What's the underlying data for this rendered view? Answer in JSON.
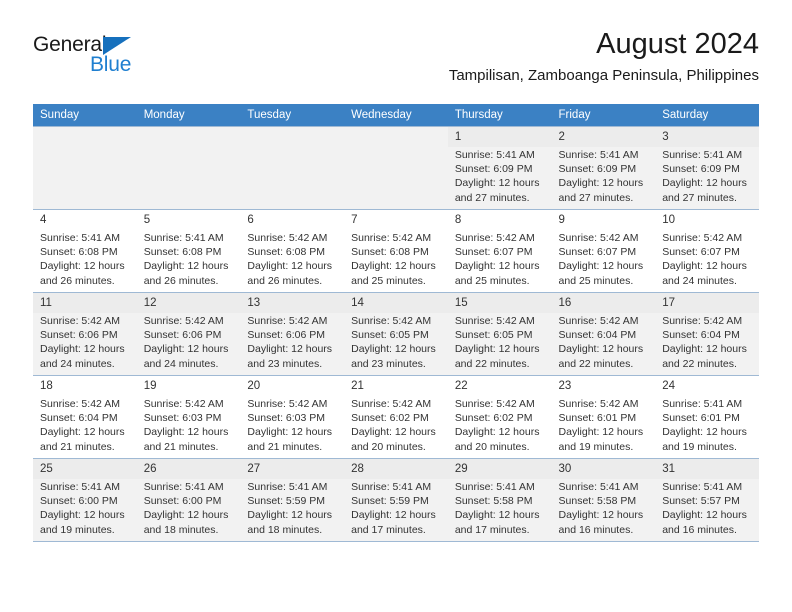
{
  "brand": {
    "name_top": "General",
    "name_bottom": "Blue",
    "triangle_color": "#1670bd",
    "blue_color": "#1f7fd0"
  },
  "header": {
    "title": "August 2024",
    "subtitle": "Tampilisan, Zamboanga Peninsula, Philippines"
  },
  "colors": {
    "header_row_bg": "#3b81c4",
    "header_row_text": "#ffffff",
    "row_border": "#9fb9d4",
    "shaded_cell": "#f2f2f2",
    "daynum_shade": "#ececec"
  },
  "weekdays": [
    "Sunday",
    "Monday",
    "Tuesday",
    "Wednesday",
    "Thursday",
    "Friday",
    "Saturday"
  ],
  "labels": {
    "sunrise_prefix": "Sunrise:",
    "sunset_prefix": "Sunset:",
    "daylight_prefix": "Daylight:"
  },
  "weeks": [
    {
      "shaded": true,
      "days": [
        {
          "date": "",
          "empty": true
        },
        {
          "date": "",
          "empty": true
        },
        {
          "date": "",
          "empty": true
        },
        {
          "date": "",
          "empty": true
        },
        {
          "date": "1",
          "sunrise": "Sunrise: 5:41 AM",
          "sunset": "Sunset: 6:09 PM",
          "daylight_line1": "Daylight: 12 hours",
          "daylight_line2": "and 27 minutes."
        },
        {
          "date": "2",
          "sunrise": "Sunrise: 5:41 AM",
          "sunset": "Sunset: 6:09 PM",
          "daylight_line1": "Daylight: 12 hours",
          "daylight_line2": "and 27 minutes."
        },
        {
          "date": "3",
          "sunrise": "Sunrise: 5:41 AM",
          "sunset": "Sunset: 6:09 PM",
          "daylight_line1": "Daylight: 12 hours",
          "daylight_line2": "and 27 minutes."
        }
      ]
    },
    {
      "shaded": false,
      "days": [
        {
          "date": "4",
          "sunrise": "Sunrise: 5:41 AM",
          "sunset": "Sunset: 6:08 PM",
          "daylight_line1": "Daylight: 12 hours",
          "daylight_line2": "and 26 minutes."
        },
        {
          "date": "5",
          "sunrise": "Sunrise: 5:41 AM",
          "sunset": "Sunset: 6:08 PM",
          "daylight_line1": "Daylight: 12 hours",
          "daylight_line2": "and 26 minutes."
        },
        {
          "date": "6",
          "sunrise": "Sunrise: 5:42 AM",
          "sunset": "Sunset: 6:08 PM",
          "daylight_line1": "Daylight: 12 hours",
          "daylight_line2": "and 26 minutes."
        },
        {
          "date": "7",
          "sunrise": "Sunrise: 5:42 AM",
          "sunset": "Sunset: 6:08 PM",
          "daylight_line1": "Daylight: 12 hours",
          "daylight_line2": "and 25 minutes."
        },
        {
          "date": "8",
          "sunrise": "Sunrise: 5:42 AM",
          "sunset": "Sunset: 6:07 PM",
          "daylight_line1": "Daylight: 12 hours",
          "daylight_line2": "and 25 minutes."
        },
        {
          "date": "9",
          "sunrise": "Sunrise: 5:42 AM",
          "sunset": "Sunset: 6:07 PM",
          "daylight_line1": "Daylight: 12 hours",
          "daylight_line2": "and 25 minutes."
        },
        {
          "date": "10",
          "sunrise": "Sunrise: 5:42 AM",
          "sunset": "Sunset: 6:07 PM",
          "daylight_line1": "Daylight: 12 hours",
          "daylight_line2": "and 24 minutes."
        }
      ]
    },
    {
      "shaded": true,
      "days": [
        {
          "date": "11",
          "sunrise": "Sunrise: 5:42 AM",
          "sunset": "Sunset: 6:06 PM",
          "daylight_line1": "Daylight: 12 hours",
          "daylight_line2": "and 24 minutes."
        },
        {
          "date": "12",
          "sunrise": "Sunrise: 5:42 AM",
          "sunset": "Sunset: 6:06 PM",
          "daylight_line1": "Daylight: 12 hours",
          "daylight_line2": "and 24 minutes."
        },
        {
          "date": "13",
          "sunrise": "Sunrise: 5:42 AM",
          "sunset": "Sunset: 6:06 PM",
          "daylight_line1": "Daylight: 12 hours",
          "daylight_line2": "and 23 minutes."
        },
        {
          "date": "14",
          "sunrise": "Sunrise: 5:42 AM",
          "sunset": "Sunset: 6:05 PM",
          "daylight_line1": "Daylight: 12 hours",
          "daylight_line2": "and 23 minutes."
        },
        {
          "date": "15",
          "sunrise": "Sunrise: 5:42 AM",
          "sunset": "Sunset: 6:05 PM",
          "daylight_line1": "Daylight: 12 hours",
          "daylight_line2": "and 22 minutes."
        },
        {
          "date": "16",
          "sunrise": "Sunrise: 5:42 AM",
          "sunset": "Sunset: 6:04 PM",
          "daylight_line1": "Daylight: 12 hours",
          "daylight_line2": "and 22 minutes."
        },
        {
          "date": "17",
          "sunrise": "Sunrise: 5:42 AM",
          "sunset": "Sunset: 6:04 PM",
          "daylight_line1": "Daylight: 12 hours",
          "daylight_line2": "and 22 minutes."
        }
      ]
    },
    {
      "shaded": false,
      "days": [
        {
          "date": "18",
          "sunrise": "Sunrise: 5:42 AM",
          "sunset": "Sunset: 6:04 PM",
          "daylight_line1": "Daylight: 12 hours",
          "daylight_line2": "and 21 minutes."
        },
        {
          "date": "19",
          "sunrise": "Sunrise: 5:42 AM",
          "sunset": "Sunset: 6:03 PM",
          "daylight_line1": "Daylight: 12 hours",
          "daylight_line2": "and 21 minutes."
        },
        {
          "date": "20",
          "sunrise": "Sunrise: 5:42 AM",
          "sunset": "Sunset: 6:03 PM",
          "daylight_line1": "Daylight: 12 hours",
          "daylight_line2": "and 21 minutes."
        },
        {
          "date": "21",
          "sunrise": "Sunrise: 5:42 AM",
          "sunset": "Sunset: 6:02 PM",
          "daylight_line1": "Daylight: 12 hours",
          "daylight_line2": "and 20 minutes."
        },
        {
          "date": "22",
          "sunrise": "Sunrise: 5:42 AM",
          "sunset": "Sunset: 6:02 PM",
          "daylight_line1": "Daylight: 12 hours",
          "daylight_line2": "and 20 minutes."
        },
        {
          "date": "23",
          "sunrise": "Sunrise: 5:42 AM",
          "sunset": "Sunset: 6:01 PM",
          "daylight_line1": "Daylight: 12 hours",
          "daylight_line2": "and 19 minutes."
        },
        {
          "date": "24",
          "sunrise": "Sunrise: 5:41 AM",
          "sunset": "Sunset: 6:01 PM",
          "daylight_line1": "Daylight: 12 hours",
          "daylight_line2": "and 19 minutes."
        }
      ]
    },
    {
      "shaded": true,
      "days": [
        {
          "date": "25",
          "sunrise": "Sunrise: 5:41 AM",
          "sunset": "Sunset: 6:00 PM",
          "daylight_line1": "Daylight: 12 hours",
          "daylight_line2": "and 19 minutes."
        },
        {
          "date": "26",
          "sunrise": "Sunrise: 5:41 AM",
          "sunset": "Sunset: 6:00 PM",
          "daylight_line1": "Daylight: 12 hours",
          "daylight_line2": "and 18 minutes."
        },
        {
          "date": "27",
          "sunrise": "Sunrise: 5:41 AM",
          "sunset": "Sunset: 5:59 PM",
          "daylight_line1": "Daylight: 12 hours",
          "daylight_line2": "and 18 minutes."
        },
        {
          "date": "28",
          "sunrise": "Sunrise: 5:41 AM",
          "sunset": "Sunset: 5:59 PM",
          "daylight_line1": "Daylight: 12 hours",
          "daylight_line2": "and 17 minutes."
        },
        {
          "date": "29",
          "sunrise": "Sunrise: 5:41 AM",
          "sunset": "Sunset: 5:58 PM",
          "daylight_line1": "Daylight: 12 hours",
          "daylight_line2": "and 17 minutes."
        },
        {
          "date": "30",
          "sunrise": "Sunrise: 5:41 AM",
          "sunset": "Sunset: 5:58 PM",
          "daylight_line1": "Daylight: 12 hours",
          "daylight_line2": "and 16 minutes."
        },
        {
          "date": "31",
          "sunrise": "Sunrise: 5:41 AM",
          "sunset": "Sunset: 5:57 PM",
          "daylight_line1": "Daylight: 12 hours",
          "daylight_line2": "and 16 minutes."
        }
      ]
    }
  ]
}
